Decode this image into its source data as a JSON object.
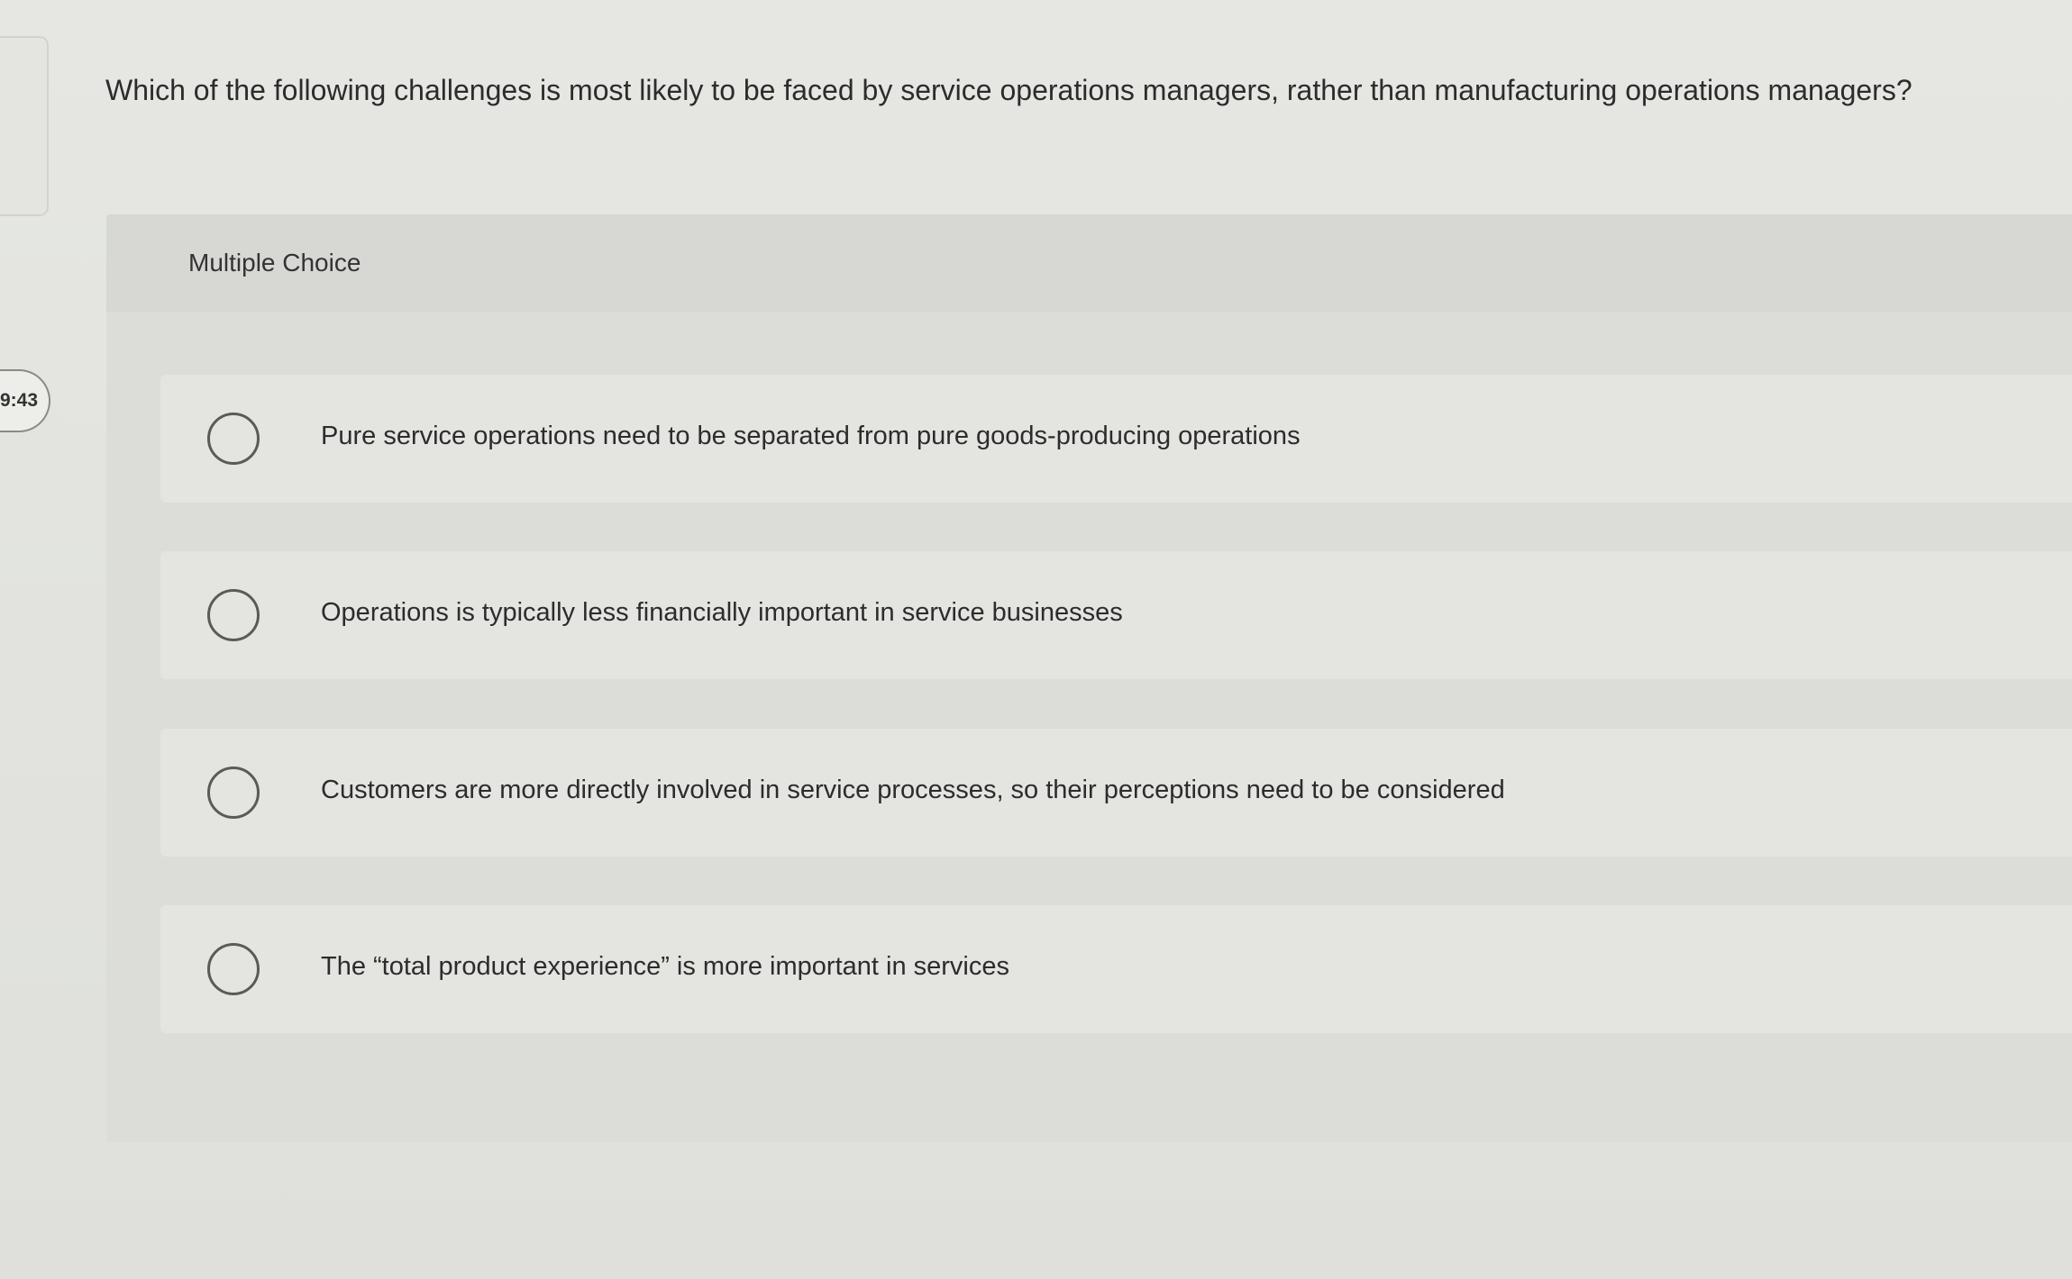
{
  "sidebar": {
    "timer_text": "9:43"
  },
  "question": {
    "text": "Which of the following challenges is most likely to be faced by service operations managers, rather than manufacturing operations managers?",
    "type_label": "Multiple Choice"
  },
  "options": [
    {
      "label": "Pure service operations need to be separated from pure goods-producing operations"
    },
    {
      "label": "Operations is typically less financially important in service businesses"
    },
    {
      "label": "Customers are more directly involved in service processes, so their perceptions need to be considered"
    },
    {
      "label": "The “total product experience” is more important in services"
    }
  ],
  "colors": {
    "background": "#e2e3df",
    "panel": "#dcddd9",
    "option_background": "#e4e5e1",
    "radio_border": "#5a5b58",
    "text": "#2c2c2c"
  }
}
